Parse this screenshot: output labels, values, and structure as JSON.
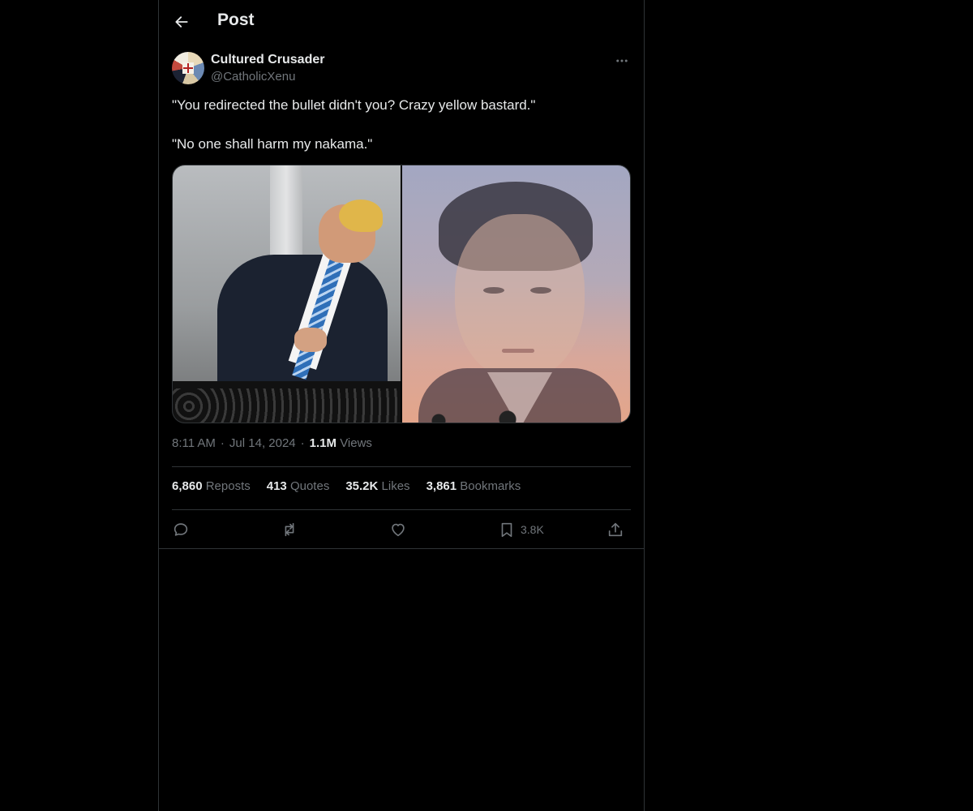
{
  "header": {
    "title": "Post",
    "back_icon": "arrow-left-icon"
  },
  "post": {
    "author": {
      "name": "Cultured Crusader",
      "handle": "@CatholicXenu"
    },
    "text_lines": [
      "\"You redirected the bullet didn't you? Crazy yellow bastard.\"",
      "\"No one shall harm my nakama.\""
    ],
    "media": [
      {
        "description": "man looking up at the sky on a balcony"
      },
      {
        "description": "portrait of a man against a sunset sky"
      }
    ],
    "time": "8:11 AM",
    "date": "Jul 14, 2024",
    "views_count": "1.1M",
    "views_label": "Views",
    "stats": [
      {
        "count": "6,860",
        "label": "Reposts"
      },
      {
        "count": "413",
        "label": "Quotes"
      },
      {
        "count": "35.2K",
        "label": "Likes"
      },
      {
        "count": "3,861",
        "label": "Bookmarks"
      }
    ],
    "actions": {
      "reply_icon": "reply-icon",
      "repost_icon": "repost-icon",
      "like_icon": "heart-icon",
      "bookmark_icon": "bookmark-icon",
      "bookmark_count": "3.8K",
      "share_icon": "share-icon"
    }
  },
  "colors": {
    "background": "#000000",
    "text": "#e7e9ea",
    "muted": "#71767b",
    "border": "#2f3336"
  }
}
